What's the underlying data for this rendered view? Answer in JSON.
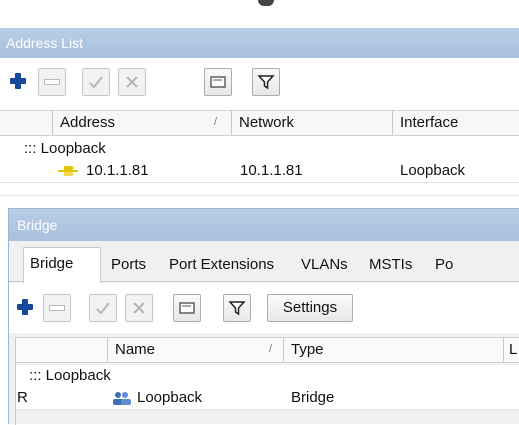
{
  "address_list": {
    "title": "Address List",
    "toolbar": {
      "add": "add-icon",
      "remove": "remove-icon",
      "enable": "check-icon",
      "disable": "cross-icon",
      "comment": "comment-icon",
      "filter": "filter-icon"
    },
    "columns": [
      "Address",
      "Network",
      "Interface"
    ],
    "sort_indicator": "/",
    "group": "::: Loopback",
    "rows": [
      {
        "address": "10.1.1.81",
        "network": "10.1.1.81",
        "interface": "Loopback"
      }
    ]
  },
  "bridge": {
    "title": "Bridge",
    "tabs": [
      "Bridge",
      "Ports",
      "Port Extensions",
      "VLANs",
      "MSTIs",
      "Po"
    ],
    "active_tab": "Bridge",
    "toolbar": {
      "settings_label": "Settings"
    },
    "columns": [
      "Name",
      "Type",
      "L"
    ],
    "sort_indicator": "/",
    "group": "::: Loopback",
    "rows": [
      {
        "flag": "R",
        "name": "Loopback",
        "type": "Bridge"
      }
    ]
  },
  "colors": {
    "titlebar": "#b2c9e4",
    "add_icon": "#15499a",
    "address_icon": "#e6c400",
    "bridge_icon": "#3d6fb6"
  }
}
